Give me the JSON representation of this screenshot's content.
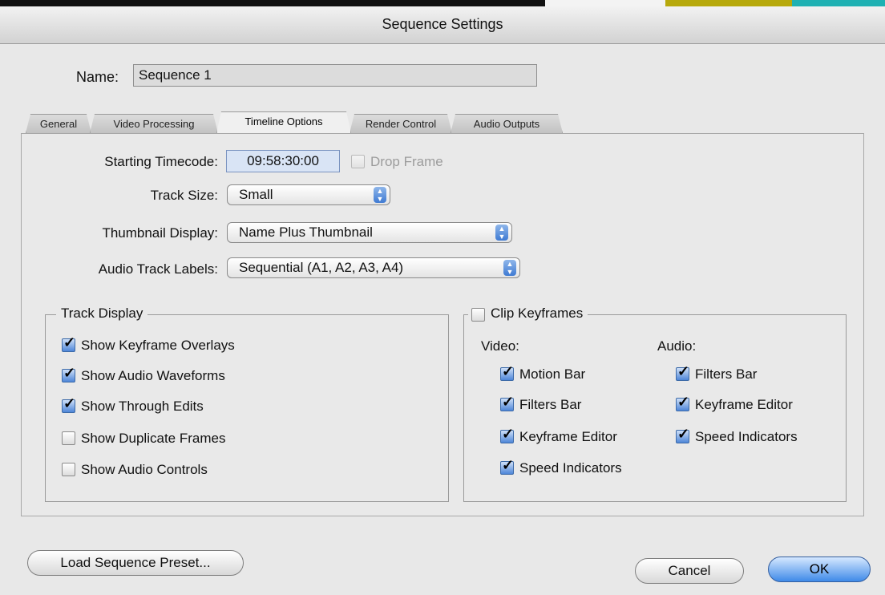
{
  "window": {
    "title": "Sequence Settings"
  },
  "name": {
    "label": "Name:",
    "value": "Sequence 1"
  },
  "tabs": [
    {
      "label": "General",
      "active": false
    },
    {
      "label": "Video Processing",
      "active": false
    },
    {
      "label": "Timeline Options",
      "active": true
    },
    {
      "label": "Render Control",
      "active": false
    },
    {
      "label": "Audio Outputs",
      "active": false
    }
  ],
  "timeline": {
    "starting_timecode": {
      "label": "Starting Timecode:",
      "value": "09:58:30:00"
    },
    "drop_frame": {
      "label": "Drop Frame",
      "checked": false,
      "enabled": false
    },
    "track_size": {
      "label": "Track Size:",
      "value": "Small"
    },
    "thumbnail_display": {
      "label": "Thumbnail Display:",
      "value": "Name Plus Thumbnail"
    },
    "audio_track_labels": {
      "label": "Audio Track Labels:",
      "value": "Sequential (A1, A2, A3, A4)"
    }
  },
  "track_display": {
    "title": "Track Display",
    "items": [
      {
        "label": "Show Keyframe Overlays",
        "checked": true
      },
      {
        "label": "Show Audio Waveforms",
        "checked": true
      },
      {
        "label": "Show Through Edits",
        "checked": true
      },
      {
        "label": "Show Duplicate Frames",
        "checked": false
      },
      {
        "label": "Show Audio Controls",
        "checked": false
      }
    ]
  },
  "clip_keyframes": {
    "title": "Clip Keyframes",
    "checked": false,
    "video": {
      "heading": "Video:",
      "items": [
        {
          "label": "Motion Bar",
          "checked": true
        },
        {
          "label": "Filters Bar",
          "checked": true
        },
        {
          "label": "Keyframe Editor",
          "checked": true
        },
        {
          "label": "Speed Indicators",
          "checked": true
        }
      ]
    },
    "audio": {
      "heading": "Audio:",
      "items": [
        {
          "label": "Filters Bar",
          "checked": true
        },
        {
          "label": "Keyframe Editor",
          "checked": true
        },
        {
          "label": "Speed Indicators",
          "checked": true
        }
      ]
    }
  },
  "buttons": {
    "load_preset": "Load Sequence Preset...",
    "cancel": "Cancel",
    "ok": "OK"
  },
  "colors": {
    "accent": "#3f8ae8",
    "checkbox_checked": "#4e86d8"
  }
}
